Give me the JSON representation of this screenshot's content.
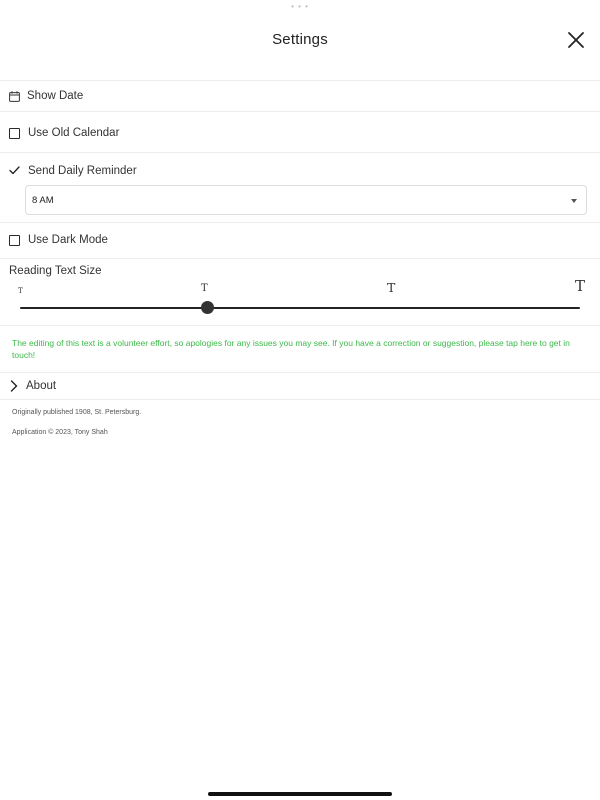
{
  "header": {
    "title": "Settings",
    "close_icon": "close-icon"
  },
  "settings": {
    "show_date": {
      "label": "Show Date",
      "icon": "calendar-icon"
    },
    "use_old_calendar": {
      "label": "Use Old Calendar",
      "checked": false
    },
    "send_daily_reminder": {
      "label": "Send Daily Reminder",
      "checked": true
    },
    "reminder_time": {
      "selected": "8 AM"
    },
    "use_dark_mode": {
      "label": "Use Dark Mode",
      "checked": false
    },
    "reading_text_size": {
      "label": "Reading Text Size",
      "glyphs": [
        "T",
        "T",
        "T",
        "T"
      ],
      "levels": 4,
      "selected_index": 1
    }
  },
  "notice": {
    "text": "The editing of this text is a volunteer effort, so apologies for any issues you may see.  If you have a correction or suggestion, please tap here to get in touch!",
    "color": "#3cb94a"
  },
  "about": {
    "label": "About",
    "icon": "chevron-right-icon"
  },
  "footer": {
    "published": "Originally published 1908, St. Petersburg.",
    "copyright": "Application © 2023, Tony Shah"
  }
}
